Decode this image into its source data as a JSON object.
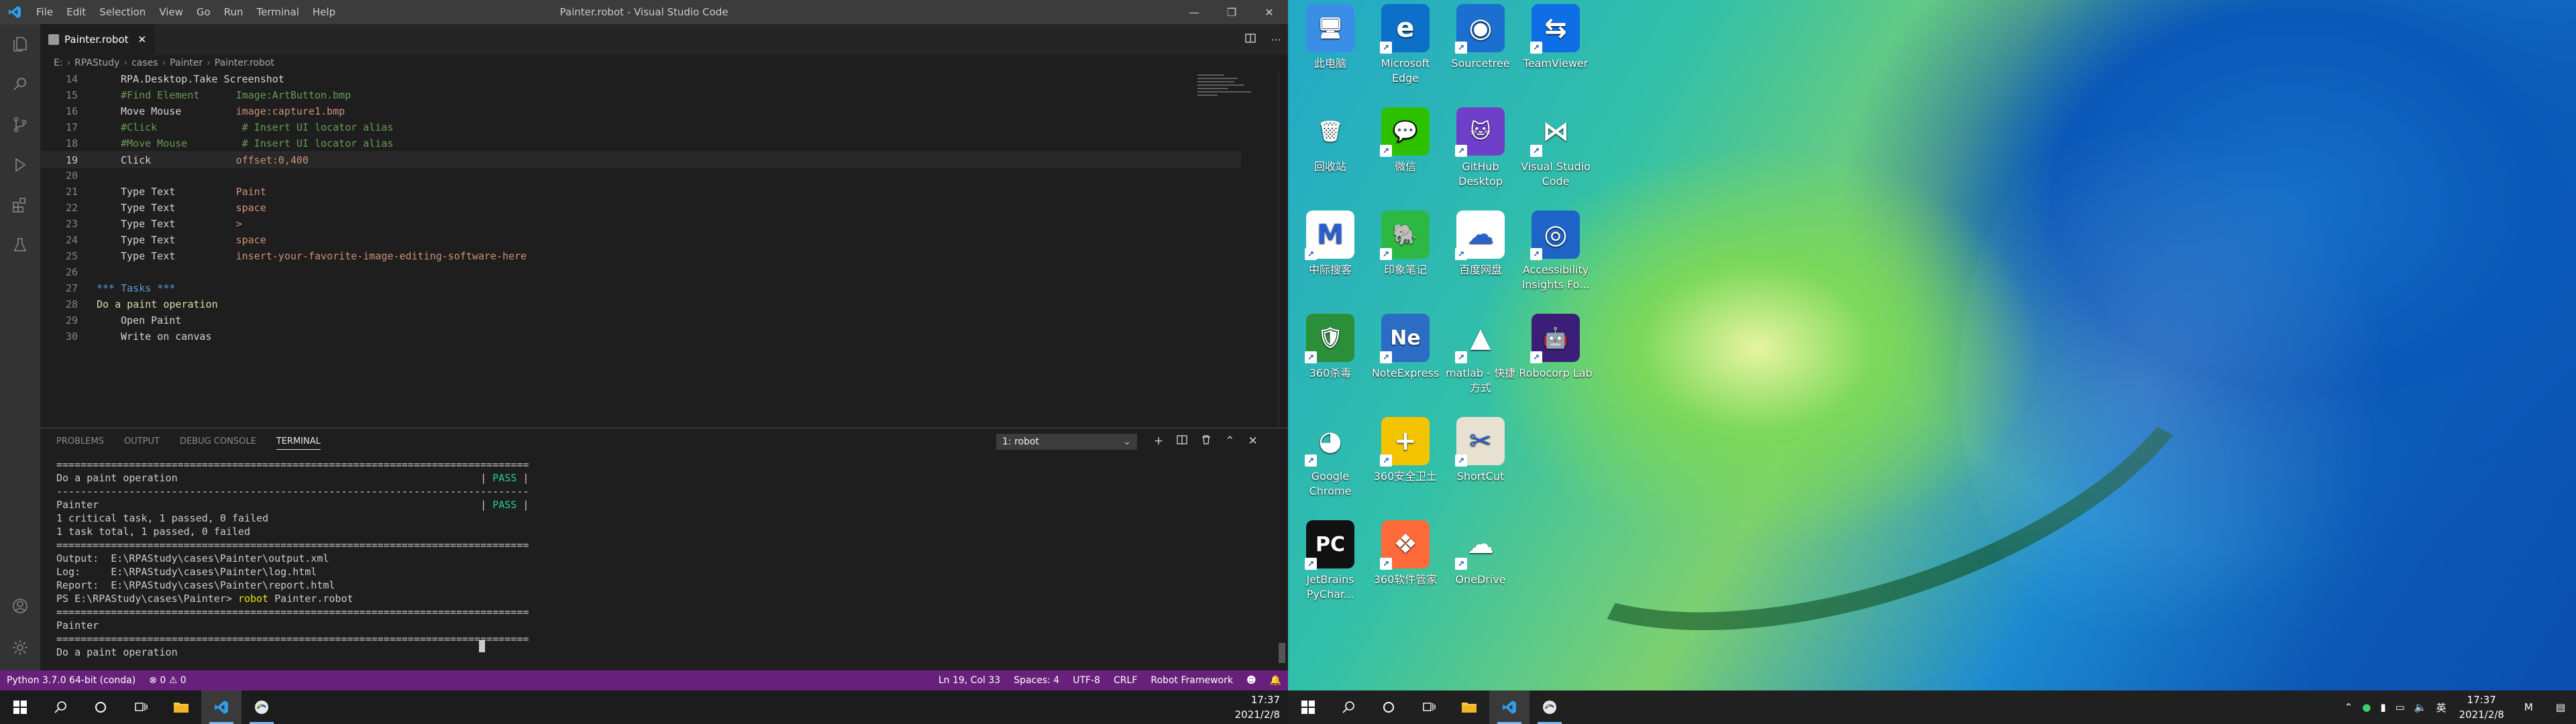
{
  "vscode": {
    "menu": [
      "File",
      "Edit",
      "Selection",
      "View",
      "Go",
      "Run",
      "Terminal",
      "Help"
    ],
    "window_title": "Painter.robot - Visual Studio Code",
    "tab_label": "Painter.robot",
    "breadcrumb": [
      "E:",
      "RPAStudy",
      "cases",
      "Painter",
      "Painter.robot"
    ],
    "code_lines": [
      {
        "n": "14",
        "parts": [
          [
            "kw",
            "RPA.Desktop.Take Screenshot"
          ]
        ]
      },
      {
        "n": "15",
        "parts": [
          [
            "cm",
            "#Find Element      Image:ArtButton.bmp"
          ]
        ]
      },
      {
        "n": "16",
        "parts": [
          [
            "kw",
            "Move Mouse         "
          ],
          [
            "ar",
            "image:capture1.bmp"
          ]
        ]
      },
      {
        "n": "17",
        "parts": [
          [
            "cm",
            "#Click              # Insert UI locator alias"
          ]
        ]
      },
      {
        "n": "18",
        "parts": [
          [
            "cm",
            "#Move Mouse         # Insert UI locator alias"
          ]
        ]
      },
      {
        "n": "19",
        "parts": [
          [
            "kw",
            "Click              "
          ],
          [
            "ar",
            "offset:0,400"
          ]
        ]
      },
      {
        "n": "20",
        "parts": []
      },
      {
        "n": "21",
        "parts": [
          [
            "kw",
            "Type Text          "
          ],
          [
            "ar",
            "Paint"
          ]
        ]
      },
      {
        "n": "22",
        "parts": [
          [
            "kw",
            "Type Text          "
          ],
          [
            "ar",
            "space"
          ]
        ]
      },
      {
        "n": "23",
        "parts": [
          [
            "kw",
            "Type Text          "
          ],
          [
            "ar",
            ">"
          ]
        ]
      },
      {
        "n": "24",
        "parts": [
          [
            "kw",
            "Type Text          "
          ],
          [
            "ar",
            "space"
          ]
        ]
      },
      {
        "n": "25",
        "parts": [
          [
            "kw",
            "Type Text          "
          ],
          [
            "ar",
            "insert-your-favorite-image-editing-software-here"
          ]
        ]
      },
      {
        "n": "26",
        "parts": []
      },
      {
        "n": "27",
        "parts": [
          [
            "hd",
            "*** Tasks ***"
          ]
        ],
        "indent": 0
      },
      {
        "n": "28",
        "parts": [
          [
            "tk",
            "Do a paint operation"
          ]
        ],
        "indent": 0
      },
      {
        "n": "29",
        "parts": [
          [
            "kw",
            "Open Paint"
          ]
        ]
      },
      {
        "n": "30",
        "parts": [
          [
            "kw",
            "Write on canvas"
          ]
        ]
      }
    ],
    "current_line": "19",
    "panel_tabs": [
      "PROBLEMS",
      "OUTPUT",
      "DEBUG CONSOLE",
      "TERMINAL"
    ],
    "terminal_select": "1: robot",
    "terminal_lines": [
      "==============================================================================",
      "Do a paint operation                                                  | PASS |",
      "------------------------------------------------------------------------------",
      "Painter                                                               | PASS |",
      "1 critical task, 1 passed, 0 failed",
      "1 task total, 1 passed, 0 failed",
      "==============================================================================",
      "Output:  E:\\RPAStudy\\cases\\Painter\\output.xml",
      "Log:     E:\\RPAStudy\\cases\\Painter\\log.html",
      "Report:  E:\\RPAStudy\\cases\\Painter\\report.html",
      "PS E:\\RPAStudy\\cases\\Painter> robot Painter.robot",
      "==============================================================================",
      "Painter",
      "==============================================================================",
      "Do a paint operation"
    ],
    "status": {
      "python": "Python 3.7.0 64-bit (conda)",
      "errors": "0",
      "warnings": "0",
      "position": "Ln 19, Col 33",
      "spaces": "Spaces: 4",
      "encoding": "UTF-8",
      "eol": "CRLF",
      "language": "Robot Framework"
    }
  },
  "taskbar_left": {
    "time": "17:37",
    "date": "2021/2/8"
  },
  "taskbar_right": {
    "time": "17:37",
    "date": "2021/2/8",
    "ime": "英"
  },
  "desktop_icons": [
    {
      "label": "此电脑",
      "color": "#3a8ee6",
      "glyph": "🖥"
    },
    {
      "label": "Microsoft Edge",
      "color": "#0c6fc8",
      "glyph": "e"
    },
    {
      "label": "Sourcetree",
      "color": "#1a6fd0",
      "glyph": "◉"
    },
    {
      "label": "TeamViewer",
      "color": "#0e6ee6",
      "glyph": "⇆"
    },
    {
      "label": "回收站",
      "color": "transparent",
      "glyph": "🗑"
    },
    {
      "label": "微信",
      "color": "#2dc100",
      "glyph": "💬"
    },
    {
      "label": "GitHub Desktop",
      "color": "#6e40c9",
      "glyph": "🐱"
    },
    {
      "label": "Visual Studio Code",
      "color": "transparent",
      "glyph": "⋈"
    },
    {
      "label": "中际搜客",
      "color": "#ffffff",
      "glyph": "M"
    },
    {
      "label": "印象笔记",
      "color": "#2db843",
      "glyph": "🐘"
    },
    {
      "label": "百度网盘",
      "color": "#ffffff",
      "glyph": "☁"
    },
    {
      "label": "Accessibility Insights Fo...",
      "color": "#1e63c6",
      "glyph": "◎"
    },
    {
      "label": "360杀毒",
      "color": "#2b8f3a",
      "glyph": "🛡"
    },
    {
      "label": "NoteExpress",
      "color": "#2b6cc4",
      "glyph": "Ne"
    },
    {
      "label": "matlab - 快捷方式",
      "color": "transparent",
      "glyph": "▲"
    },
    {
      "label": "Robocorp Lab",
      "color": "#3a1e78",
      "glyph": "🤖"
    },
    {
      "label": "Google Chrome",
      "color": "transparent",
      "glyph": "◕"
    },
    {
      "label": "360安全卫士",
      "color": "#f5c400",
      "glyph": "+"
    },
    {
      "label": "ShortCut",
      "color": "#e8e0d0",
      "glyph": "✂"
    },
    {
      "label": "JetBrains PyChar...",
      "color": "#111111",
      "glyph": "PC"
    },
    {
      "label": "360软件管家",
      "color": "#ff6a3a",
      "glyph": "❖"
    },
    {
      "label": "OneDrive",
      "color": "transparent",
      "glyph": "☁"
    }
  ]
}
